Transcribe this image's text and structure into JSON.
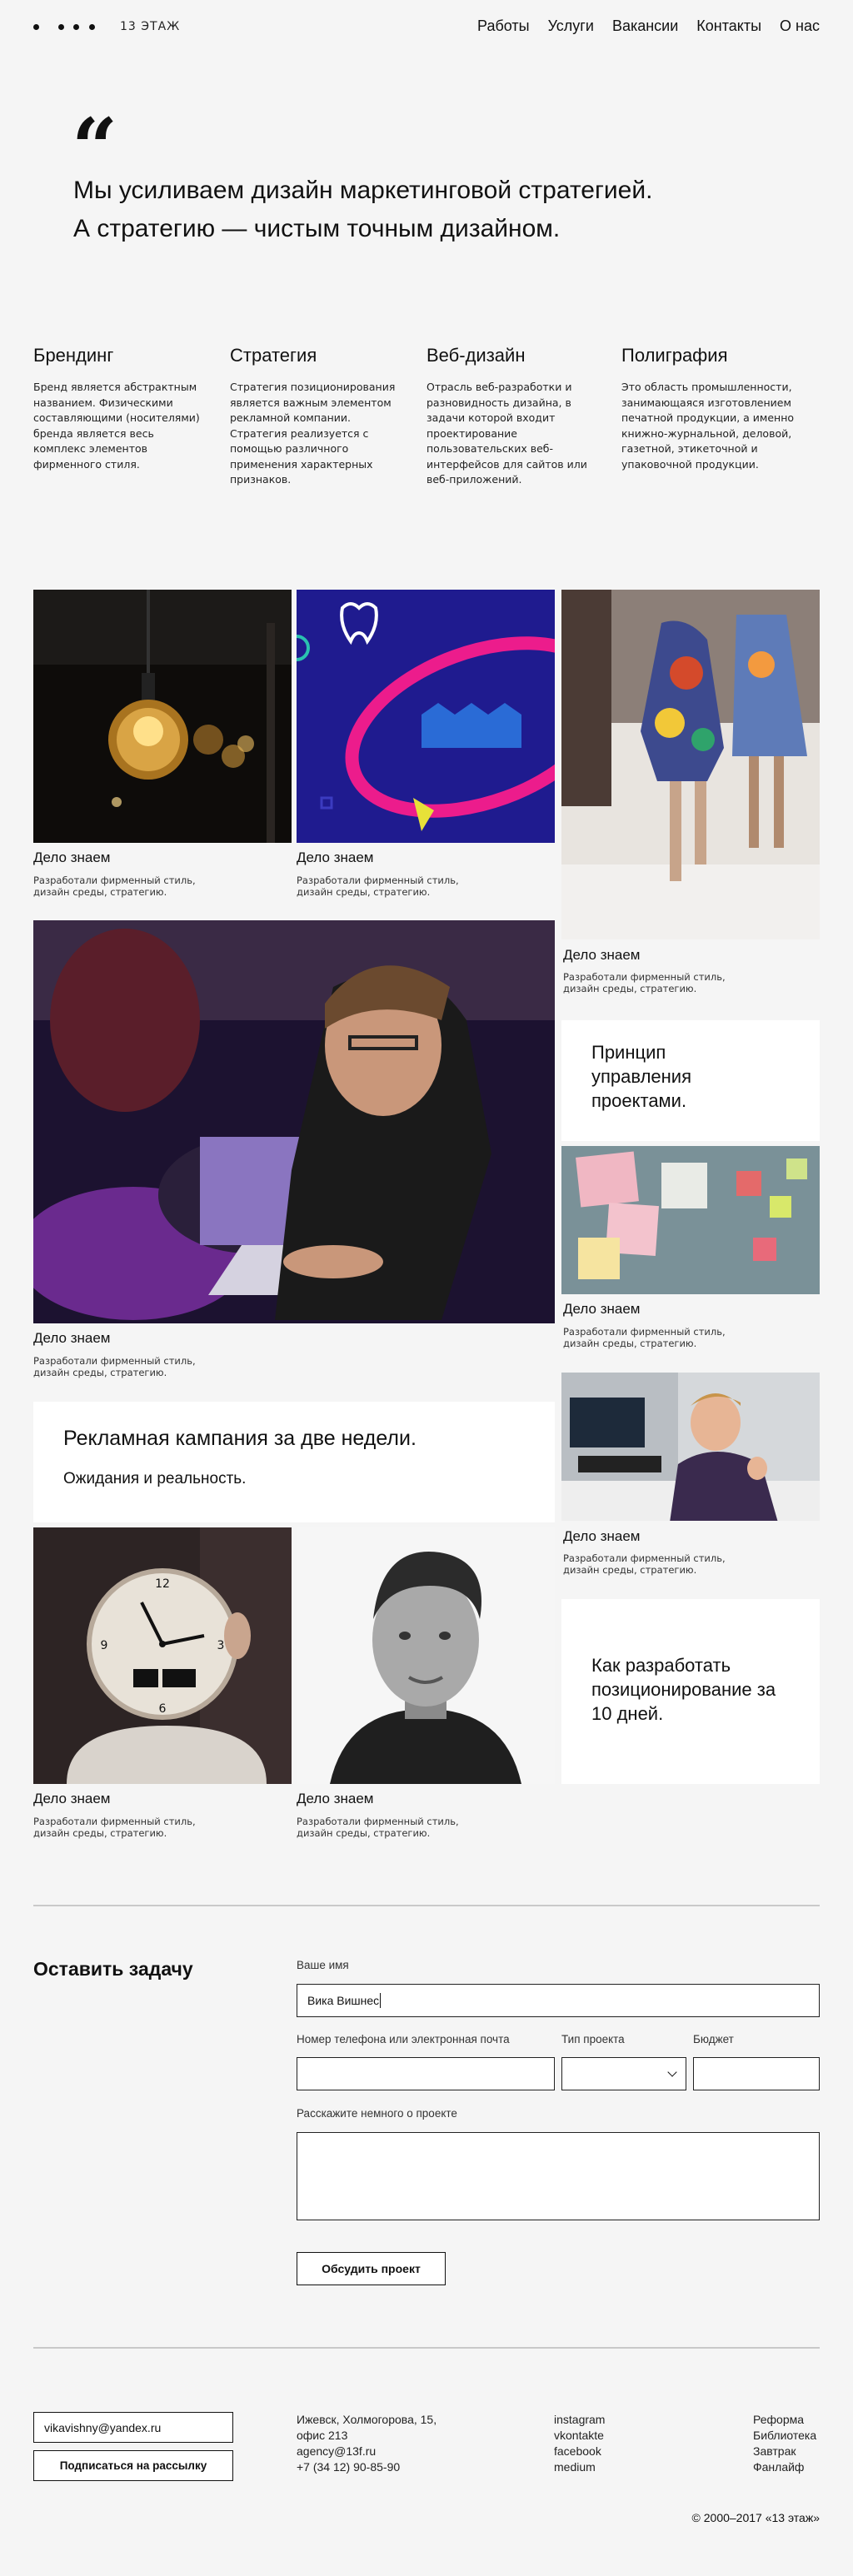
{
  "header": {
    "logo_text": "13 ЭТАЖ",
    "nav": [
      "Работы",
      "Услуги",
      "Вакансии",
      "Контакты",
      "О нас"
    ]
  },
  "hero": {
    "line1": "Мы усиливаем дизайн маркетинговой стратегией.",
    "line2": "А стратегию — чистым точным дизайном."
  },
  "services": [
    {
      "title": "Брендинг",
      "text": "Бренд является абстрактным названием. Физическими составляющими (носителями) бренда является весь комплекс элементов фирменного стиля."
    },
    {
      "title": "Стратегия",
      "text": "Стратегия позиционирования является важным элементом рекламной компании. Стратегия реализуется с помощью различного применения характерных признаков."
    },
    {
      "title": "Веб-дизайн",
      "text": "Отрасль веб-разработки и разновидность дизайна, в задачи которой входит проектирование пользовательских веб-интерфейсов для сайтов или веб-приложений."
    },
    {
      "title": "Полиграфия",
      "text": "Это область промышленности, занимающаяся изготовлением печатной продукции, а именно книжно-журнальной, деловой, газетной, этикеточной и упаковочной продукции."
    }
  ],
  "project": {
    "title": "Дело знаем",
    "desc": "Разработали фирменный стиль, дизайн среды, стратегию."
  },
  "cards": {
    "principle": "Принцип управления проектами.",
    "campaign_title": "Рекламная кампания за две недели.",
    "campaign_sub": "Ожидания и реальность.",
    "positioning": "Как разработать позиционирование за 10 дней."
  },
  "form": {
    "title": "Оставить задачу",
    "name_label": "Ваше имя",
    "name_value": "Вика Вишнеc",
    "phone_label": "Номер телефона или электронная почта",
    "type_label": "Тип проекта",
    "budget_label": "Бюджет",
    "about_label": "Расскажите немного о проекте",
    "submit": "Обсудить проект"
  },
  "footer": {
    "email_value": "vikavishny@yandex.ru",
    "subscribe": "Подписаться на рассылку",
    "address": [
      "Ижевск, Холмогорова, 15,",
      "офис 213",
      "agency@13f.ru",
      "+7 (34 12) 90-85-90"
    ],
    "social": [
      "instagram",
      "vkontakte",
      "facebook",
      "medium"
    ],
    "projects": [
      "Реформа",
      "Библиотека",
      "Завтрак",
      "Фанлайф"
    ],
    "copyright": "© 2000–2017 «13 этаж»"
  }
}
